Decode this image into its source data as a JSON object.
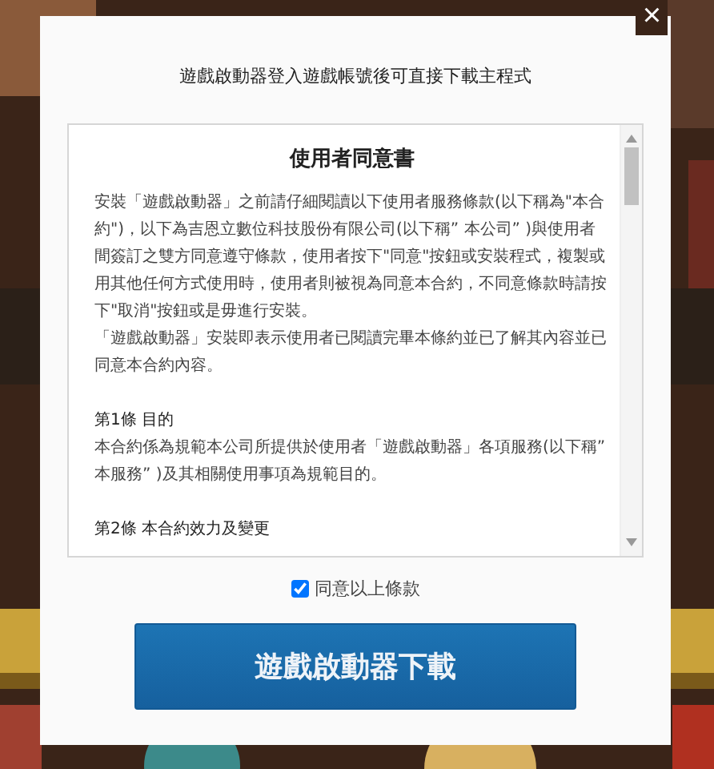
{
  "dialog": {
    "close": "×",
    "subtitle": "遊戲啟動器登入遊戲帳號後可直接下載主程式",
    "terms": {
      "title": "使用者同意書",
      "blocks": [
        {
          "kind": "paragraph",
          "text": "安裝「遊戲啟動器」之前請仔細閱讀以下使用者服務條款(以下稱為\"本合約\")，以下為吉恩立數位科技股份有限公司(以下稱” 本公司” )與使用者間簽訂之雙方同意遵守條款，使用者按下\"同意\"按鈕或安裝程式，複製或用其他任何方式使用時，使用者則被視為同意本合約，不同意條款時請按下\"取消\"按鈕或是毋進行安裝。"
        },
        {
          "kind": "paragraph",
          "text": "「遊戲啟動器」安裝即表示使用者已閱讀完畢本條約並已了解其內容並已同意本合約內容。"
        },
        {
          "kind": "heading",
          "text": "第1條 目的"
        },
        {
          "kind": "paragraph",
          "text": "本合約係為規範本公司所提供於使用者「遊戲啟動器」各項服務(以下稱” 本服務” )及其相關使用事項為規範目的。"
        },
        {
          "kind": "heading",
          "text": "第2條 本合約效力及變更"
        }
      ]
    },
    "agree": {
      "label": "同意以上條款",
      "checked": true
    },
    "download_button": "遊戲啟動器下載"
  }
}
